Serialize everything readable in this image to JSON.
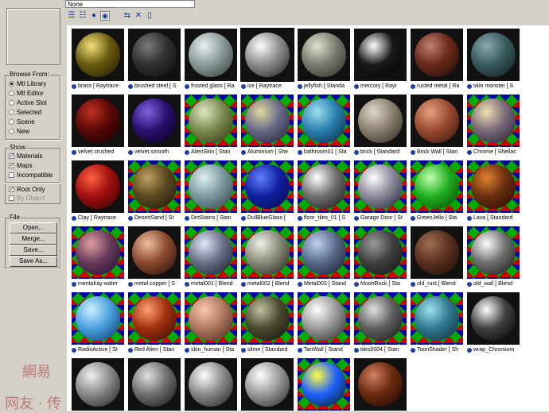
{
  "name_field": {
    "value": "None"
  },
  "browse_from": {
    "title": "Browse From:",
    "options": [
      "Mtl Library",
      "Mtl Editor",
      "Active Slot",
      "Selected",
      "Scene",
      "New"
    ],
    "selected": 0
  },
  "show": {
    "title": "Show",
    "options": [
      {
        "label": "Materials",
        "checked": true,
        "disabled": false
      },
      {
        "label": "Maps",
        "checked": true,
        "disabled": false
      },
      {
        "label": "Incompatible",
        "checked": false,
        "disabled": false
      }
    ],
    "extra": [
      {
        "label": "Root Only",
        "checked": true,
        "disabled": false
      },
      {
        "label": "By Object",
        "checked": false,
        "disabled": true
      }
    ]
  },
  "file": {
    "title": "File",
    "buttons": [
      "Open...",
      "Merge...",
      "Save...",
      "Save As..."
    ]
  },
  "toolbar": {
    "icons": [
      "view-list-icon",
      "view-list-icons-icon",
      "view-small-icons-icon",
      "view-large-icons-icon",
      "update-scene-icon",
      "delete-icon",
      "clear-library-icon"
    ]
  },
  "materials": [
    {
      "label": "brass [ Raytrace",
      "c1": "#f2e07a",
      "c2": "#6a5a10",
      "c3": "#1a1400"
    },
    {
      "label": "brushed steel [ S",
      "c1": "#7a7a7a",
      "c2": "#303030",
      "c3": "#0a0a0a"
    },
    {
      "label": "frosted glass [ Ra",
      "c1": "#e8f0f0",
      "c2": "#8a9a9a",
      "c3": "#2a3434"
    },
    {
      "label": "ice [ Raytrace",
      "c1": "#ffffff",
      "c2": "#8c8c8c",
      "c3": "#1c1c1c"
    },
    {
      "label": "jellyfish [ Standa",
      "c1": "#e0e0d0",
      "c2": "#7a7a70",
      "c3": "#2a2a24"
    },
    {
      "label": "mercury [ Rayt",
      "c1": "#ffffff",
      "c2": "#1a1a1a",
      "c3": "#000000"
    },
    {
      "label": "rusted metal [ Ra",
      "c1": "#c08070",
      "c2": "#6a2a1a",
      "c3": "#1a0a05"
    },
    {
      "label": "skin monster [ S",
      "c1": "#8aaab0",
      "c2": "#3a5a60",
      "c3": "#0a1a1c"
    },
    {
      "label": "velvet crushed",
      "c1": "#c03020",
      "c2": "#5a0808",
      "c3": "#100000"
    },
    {
      "label": "velvet smooth",
      "c1": "#8060e0",
      "c2": "#2a1070",
      "c3": "#050010"
    },
    {
      "label": "AlienSkin [ Stan",
      "c1": "#e0e8c0",
      "c2": "#7a8a50",
      "c3": "#2a3010"
    },
    {
      "label": "Aluminium [ She",
      "c1": "#e0d8a0",
      "c2": "#6a6a8a",
      "c3": "#1a1a30"
    },
    {
      "label": "bathroom01 [ Sta",
      "c1": "#a0e0f0",
      "c2": "#2a80b0",
      "c3": "#05203a"
    },
    {
      "label": "brick [ Standard",
      "c1": "#e0d8c8",
      "c2": "#8a8070",
      "c3": "#2a2418"
    },
    {
      "label": "Brick Wall [ Stan",
      "c1": "#e8a080",
      "c2": "#9a4a30",
      "c3": "#301008"
    },
    {
      "label": "Chrome [ Shellac",
      "c1": "#f0e0b0",
      "c2": "#7a6a7a",
      "c3": "#20182a"
    },
    {
      "label": "Clay [ Raytrace",
      "c1": "#ff6040",
      "c2": "#a01010",
      "c3": "#300000"
    },
    {
      "label": "DesertSand [ St",
      "c1": "#c0a060",
      "c2": "#5a4820",
      "c3": "#1a1408"
    },
    {
      "label": "DirtStains [ Stan",
      "c1": "#e0f0f0",
      "c2": "#7a9aa0",
      "c3": "#2a3a40"
    },
    {
      "label": "DullBlueGlass [",
      "c1": "#6080ff",
      "c2": "#1020a0",
      "c3": "#000840"
    },
    {
      "label": "floor_tiles_01 [ S",
      "c1": "#ffffff",
      "c2": "#707070",
      "c3": "#101010"
    },
    {
      "label": "Garage Door [ St",
      "c1": "#ffffff",
      "c2": "#8a8a9a",
      "c3": "#1a1a30"
    },
    {
      "label": "GreenJello [ Sta",
      "c1": "#c0ffb0",
      "c2": "#20b020",
      "c3": "#004000"
    },
    {
      "label": "Lava [ Standard",
      "c1": "#e08030",
      "c2": "#6a3010",
      "c3": "#200800"
    },
    {
      "label": "mentalray water",
      "c1": "#e0a0a0",
      "c2": "#6a3a5a",
      "c3": "#1a0a2a"
    },
    {
      "label": "metal copper [ S",
      "c1": "#f0c0a0",
      "c2": "#8a4a30",
      "c3": "#200a05"
    },
    {
      "label": "metal001 [ Blend",
      "c1": "#e0e8f8",
      "c2": "#6a7088",
      "c3": "#101420"
    },
    {
      "label": "metal002 [ Blend",
      "c1": "#f0f0e8",
      "c2": "#8a8a7a",
      "c3": "#1a1a14"
    },
    {
      "label": "Metal003 [ Stand",
      "c1": "#c0d0f0",
      "c2": "#5a6a8a",
      "c3": "#10182a"
    },
    {
      "label": "MoonRock [ Sta",
      "c1": "#9a9a9a",
      "c2": "#404040",
      "c3": "#101010"
    },
    {
      "label": "old_rust [ Blend",
      "c1": "#a07050",
      "c2": "#5a3020",
      "c3": "#1a0a05"
    },
    {
      "label": "old_wall [ Blend",
      "c1": "#ffffff",
      "c2": "#707070",
      "c3": "#101010"
    },
    {
      "label": "RadioActive [ St",
      "c1": "#d0f0ff",
      "c2": "#4aa0e0",
      "c3": "#0a3060"
    },
    {
      "label": "Red Alien [ Stan",
      "c1": "#ffa070",
      "c2": "#a03010",
      "c3": "#300800"
    },
    {
      "label": "skin_human [ Sta",
      "c1": "#f8c8b0",
      "c2": "#b07860",
      "c3": "#402018"
    },
    {
      "label": "slime [ Standard",
      "c1": "#c0c0a0",
      "c2": "#4a4a30",
      "c3": "#10100a"
    },
    {
      "label": "TanWall [ Stand",
      "c1": "#ffffff",
      "c2": "#9a9a9a",
      "c3": "#202020"
    },
    {
      "label": "tiles0004 [ Stan",
      "c1": "#e0e0e0",
      "c2": "#606060",
      "c3": "#101010"
    },
    {
      "label": "ToonShader [ Sh",
      "c1": "#a0e0f0",
      "c2": "#307890",
      "c3": "#0a2a34"
    },
    {
      "label": "wrap_Chromium",
      "c1": "#ffffff",
      "c2": "#404040",
      "c3": "#000000"
    },
    {
      "label": "",
      "c1": "#f0f0f0",
      "c2": "#8a8a8a",
      "c3": "#1a1a1a"
    },
    {
      "label": "",
      "c1": "#e0e0e0",
      "c2": "#707070",
      "c3": "#101010"
    },
    {
      "label": "",
      "c1": "#ffffff",
      "c2": "#8a8a8a",
      "c3": "#1a1a1a"
    },
    {
      "label": "",
      "c1": "#ffffff",
      "c2": "#9a9a9a",
      "c3": "#202020"
    },
    {
      "label": "",
      "c1": "#ffff40",
      "c2": "#2060ff",
      "c3": "#002000"
    },
    {
      "label": "",
      "c1": "#d08060",
      "c2": "#6a2a10",
      "c3": "#1a0500"
    }
  ],
  "selected_index": 3,
  "checker_bg": [
    10,
    11,
    12,
    15,
    17,
    18,
    19,
    20,
    21,
    22,
    23,
    24,
    26,
    27,
    28,
    29,
    31,
    32,
    33,
    34,
    35,
    36,
    37,
    38,
    44
  ],
  "watermark": {
    "line1": "網易",
    "line2": "网友 · 传"
  }
}
